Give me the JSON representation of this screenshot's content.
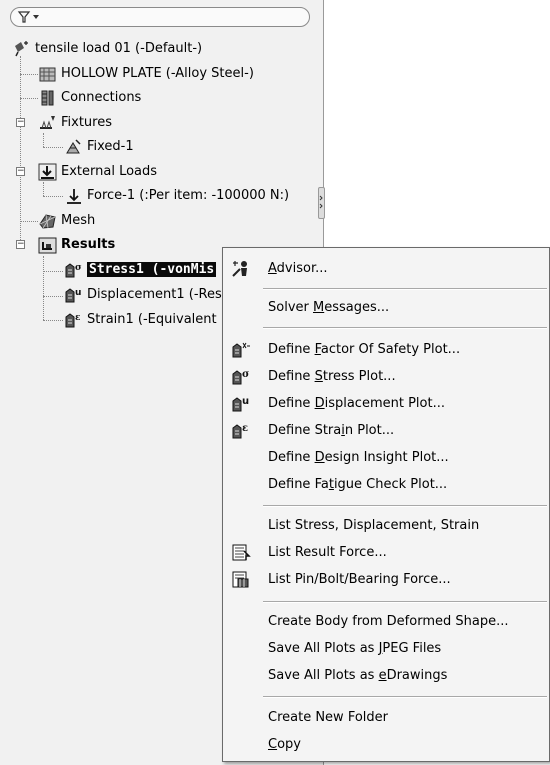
{
  "tree": {
    "filter_label": "▾",
    "root": "tensile load 01 (-Default-)",
    "part": "HOLLOW PLATE (-Alloy Steel-)",
    "connections": "Connections",
    "fixtures": "Fixtures",
    "fixed": "Fixed-1",
    "external_loads": "External Loads",
    "force": "Force-1 (:Per item: -100000 N:)",
    "mesh": "Mesh",
    "results": "Results",
    "stress": "Stress1 (-vonMis",
    "displacement": "Displacement1 (-Res",
    "strain": "Strain1 (-Equivalent"
  },
  "menu": {
    "advisor": {
      "pre": "",
      "key": "A",
      "post": "dvisor..."
    },
    "solver_messages": {
      "pre": "Solver ",
      "key": "M",
      "post": "essages..."
    },
    "define_fos": {
      "pre": "Define ",
      "key": "F",
      "post": "actor Of Safety Plot..."
    },
    "define_stress": {
      "pre": "Define ",
      "key": "S",
      "post": "tress Plot..."
    },
    "define_displacement": {
      "pre": "Define ",
      "key": "D",
      "post": "isplacement Plot..."
    },
    "define_strain": {
      "pre": "Define Stra",
      "key": "i",
      "post": "n Plot..."
    },
    "define_design_insight": {
      "pre": "Define ",
      "key": "D",
      "post": "esign Insight Plot..."
    },
    "define_fatigue": {
      "pre": "Define Fa",
      "key": "t",
      "post": "igue Check Plot..."
    },
    "list_stress": {
      "pre": "List Stress, Displacement, Strain",
      "key": "",
      "post": ""
    },
    "list_result_force": {
      "pre": "List Result Force...",
      "key": "",
      "post": ""
    },
    "list_pin_bolt": {
      "pre": "List Pin/Bolt/Bearing Force...",
      "key": "",
      "post": ""
    },
    "create_body": {
      "pre": "Create Body from Deformed Shape...",
      "key": "",
      "post": ""
    },
    "save_jpeg": {
      "pre": "Save All Plots as ",
      "key": "J",
      "post": "PEG Files"
    },
    "save_edrawings": {
      "pre": "Save All Plots as ",
      "key": "e",
      "post": "Drawings"
    },
    "create_folder": {
      "pre": "Create New Folder",
      "key": "",
      "post": ""
    },
    "copy": {
      "pre": "",
      "key": "C",
      "post": "opy"
    }
  }
}
